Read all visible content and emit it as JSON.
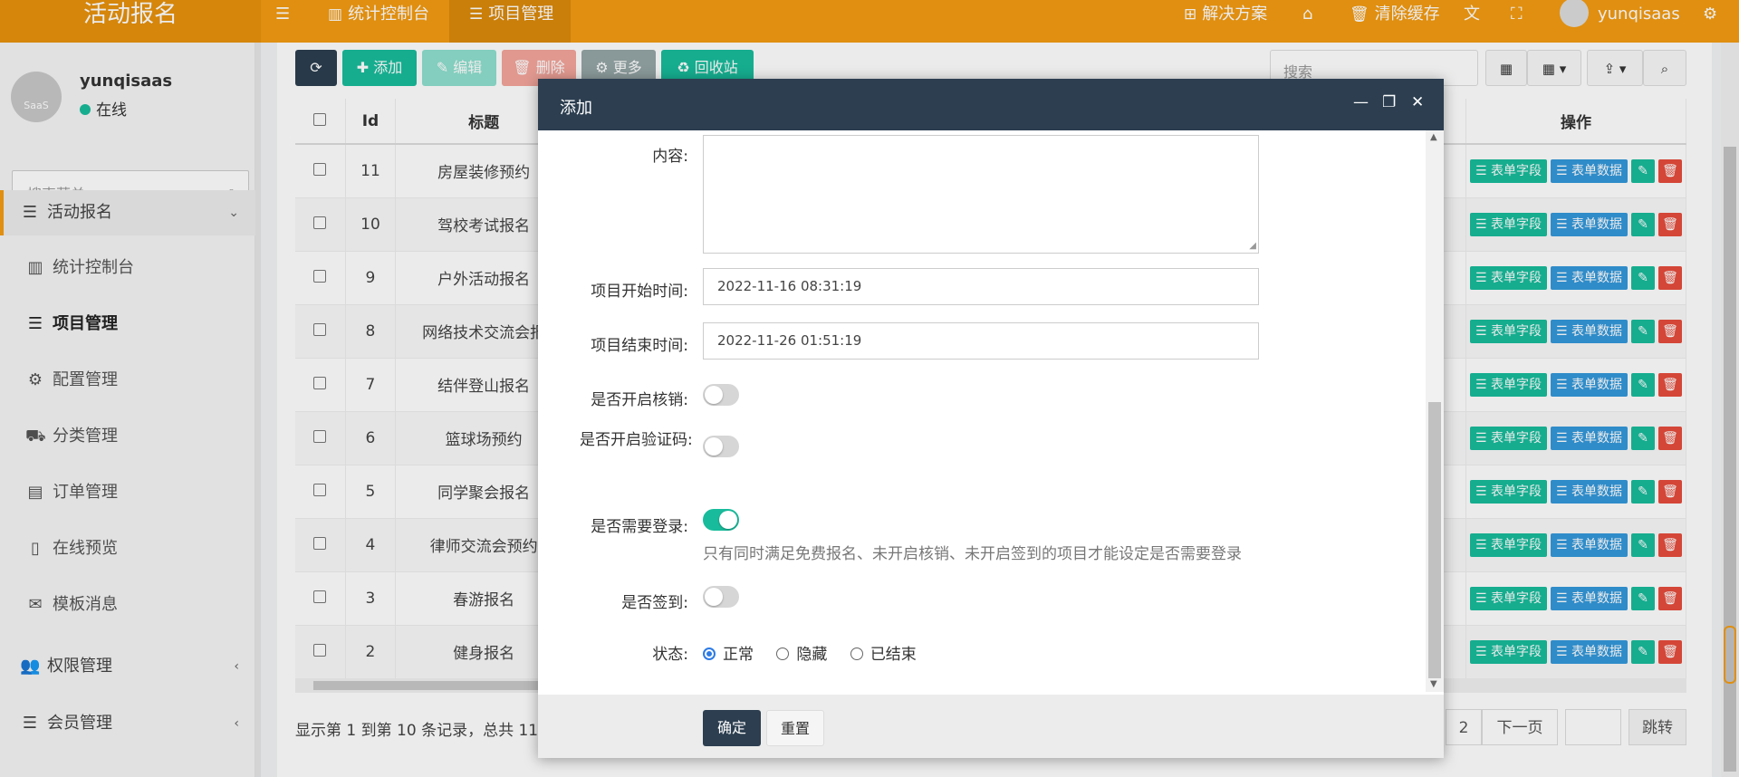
{
  "topbar": {
    "brand": "活动报名",
    "nav": [
      "统计控制台",
      "项目管理"
    ],
    "right": {
      "solutions": "解决方案",
      "clear_cache": "清除缓存",
      "username": "yunqisaas"
    }
  },
  "sidebar": {
    "user": {
      "name": "yunqisaas",
      "status": "在线",
      "avatar_text": "SaaS"
    },
    "search_placeholder": "搜索菜单",
    "items": [
      {
        "label": "活动报名"
      },
      {
        "label": "统计控制台"
      },
      {
        "label": "项目管理"
      },
      {
        "label": "配置管理"
      },
      {
        "label": "分类管理"
      },
      {
        "label": "订单管理"
      },
      {
        "label": "在线预览"
      },
      {
        "label": "模板消息"
      },
      {
        "label": "权限管理"
      },
      {
        "label": "会员管理"
      }
    ]
  },
  "toolbar": {
    "refresh": "⟳",
    "add": "添加",
    "edit": "编辑",
    "delete": "删除",
    "more": "更多",
    "recycle": "回收站",
    "search_placeholder": "搜索"
  },
  "table": {
    "headers": {
      "id": "Id",
      "title": "标题",
      "ops": "操作"
    },
    "op_labels": {
      "fields": "表单字段",
      "data": "表单数据"
    },
    "rows": [
      {
        "id": "11",
        "title": "房屋装修预约"
      },
      {
        "id": "10",
        "title": "驾校考试报名"
      },
      {
        "id": "9",
        "title": "户外活动报名"
      },
      {
        "id": "8",
        "title": "网络技术交流会报"
      },
      {
        "id": "7",
        "title": "结伴登山报名"
      },
      {
        "id": "6",
        "title": "篮球场预约"
      },
      {
        "id": "5",
        "title": "同学聚会报名"
      },
      {
        "id": "4",
        "title": "律师交流会预约"
      },
      {
        "id": "3",
        "title": "春游报名"
      },
      {
        "id": "2",
        "title": "健身报名"
      }
    ]
  },
  "pager": {
    "summary": "显示第 1 到第 10 条记录，总共 11",
    "page2": "2",
    "next": "下一页",
    "jump": "跳转"
  },
  "dialog": {
    "title": "添加",
    "fields": {
      "content_label": "内容:",
      "start_label": "项目开始时间:",
      "start_value": "2022-11-16 08:31:19",
      "end_label": "项目结束时间:",
      "end_value": "2022-11-26 01:51:19",
      "verify_label": "是否开启核销:",
      "captcha_label": "是否开启验证码:",
      "login_label": "是否需要登录:",
      "login_help": "只有同时满足免费报名、未开启核销、未开启签到的项目才能设定是否需要登录",
      "signin_label": "是否签到:",
      "status_label": "状态:",
      "status_options": [
        "正常",
        "隐藏",
        "已结束"
      ]
    },
    "switches": {
      "verify": false,
      "captcha": false,
      "login": true,
      "signin": false
    },
    "buttons": {
      "confirm": "确定",
      "reset": "重置"
    }
  },
  "colors": {
    "accent": "#f39c12",
    "dialog_header": "#2c3e50",
    "success": "#18bc9c",
    "info": "#3498db",
    "danger": "#e74c3c"
  }
}
